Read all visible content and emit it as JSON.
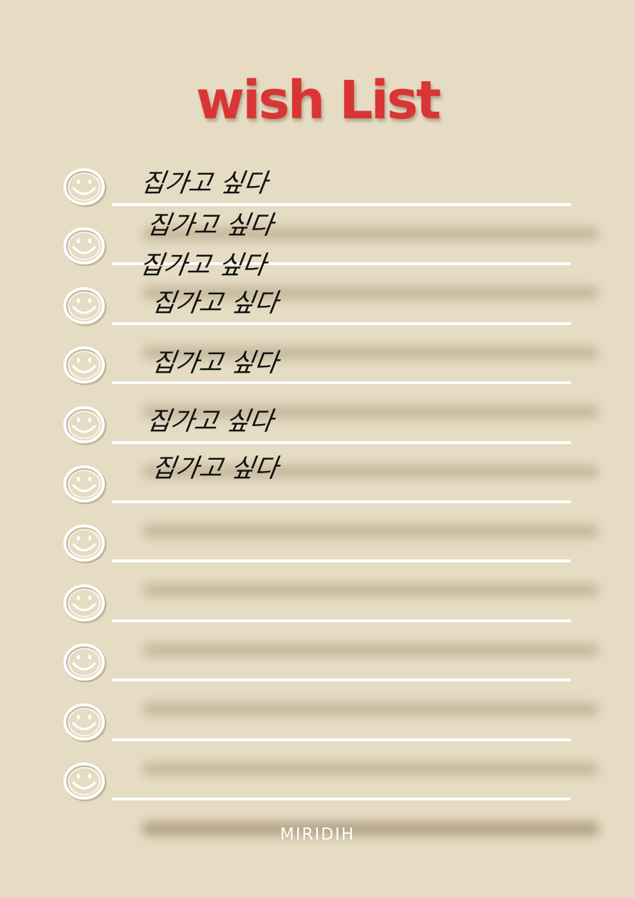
{
  "title": "wish List",
  "entries": [
    "집가고 싶다",
    "집가고 싶다",
    "집가고 싶다",
    "집가고 싶다",
    "집가고 싶다",
    "집가고 싶다",
    "집가고 싶다"
  ],
  "row_count": 11,
  "icon": "smiley-icon",
  "brand": "MIRIDIH",
  "colors": {
    "background": "#e5dcc3",
    "title": "#d93535",
    "line": "#ffffff",
    "text": "#111111"
  }
}
